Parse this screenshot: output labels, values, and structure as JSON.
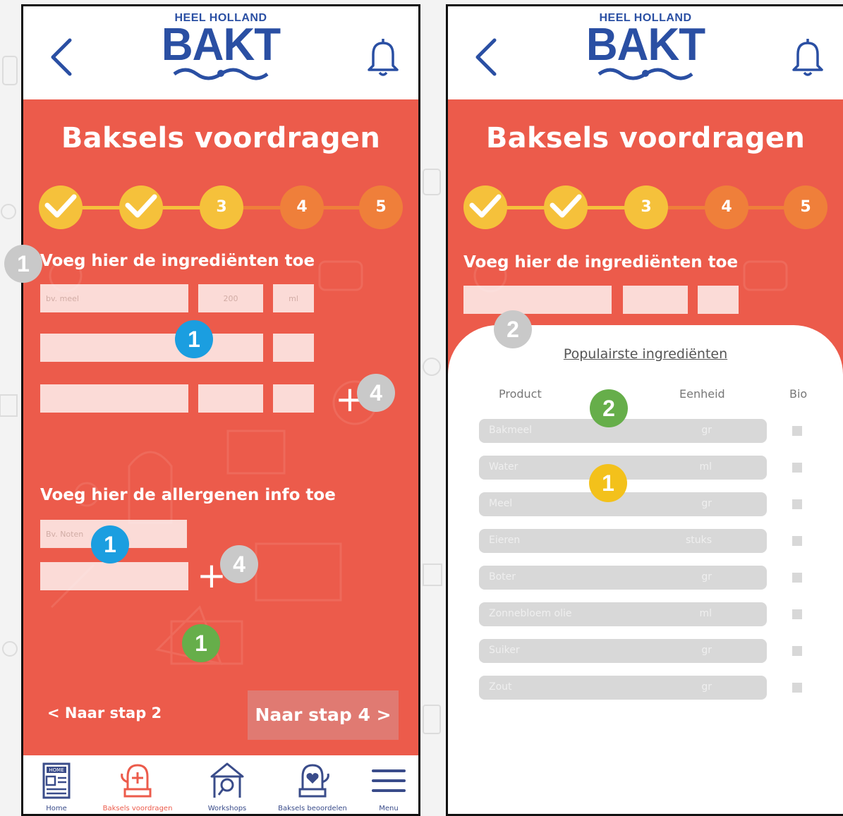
{
  "app": {
    "logo_top": "HEEL HOLLAND",
    "logo_main": "BAKT"
  },
  "left_screen": {
    "title": "Baksels voordragen",
    "steps": [
      "3",
      "4",
      "5"
    ],
    "ingredients_label": "Voeg hier de ingrediënten toe",
    "ingredient_placeholders": [
      "bv. meel",
      "200",
      "ml"
    ],
    "allergens_label": "Voeg hier de allergenen info toe",
    "allergen_placeholder": "Bv. Noten",
    "plus_symbol": "+",
    "prev_button": "< Naar stap 2",
    "next_button": "Naar stap 4 >",
    "badges": {
      "gray_1": "1",
      "blue_1": "1",
      "blue_2": "1",
      "green_1": "1",
      "gray_4a": "4",
      "gray_4b": "4"
    }
  },
  "right_screen": {
    "title": "Baksels voordragen",
    "steps": [
      "3",
      "4",
      "5"
    ],
    "ingredients_label": "Voeg hier de ingrediënten toe",
    "popular_title": "Populairste ingrediënten",
    "columns": {
      "product": "Product",
      "unit": "Eenheid",
      "bio": "Bio"
    },
    "popular_ingredients": [
      {
        "name": "Bakmeel",
        "unit": "gr"
      },
      {
        "name": "Water",
        "unit": "ml"
      },
      {
        "name": "Meel",
        "unit": "gr"
      },
      {
        "name": "Eieren",
        "unit": "stuks"
      },
      {
        "name": "Boter",
        "unit": "gr"
      },
      {
        "name": "Zonnebloem olie",
        "unit": "ml"
      },
      {
        "name": "Suiker",
        "unit": "gr"
      },
      {
        "name": "Zout",
        "unit": "gr"
      }
    ],
    "badges": {
      "gray_2": "2",
      "green_2": "2",
      "yellow_1": "1"
    }
  },
  "tabbar": {
    "items": [
      {
        "label": "Home",
        "icon": "newspaper-icon"
      },
      {
        "label": "Baksels voordragen",
        "icon": "oven-mitt-plus-icon"
      },
      {
        "label": "Workshops",
        "icon": "tent-search-icon"
      },
      {
        "label": "Baksels beoordelen",
        "icon": "oven-mitt-heart-icon"
      },
      {
        "label": "Menu",
        "icon": "hamburger-menu-icon"
      }
    ],
    "home_icon_text": "HOME"
  },
  "colors": {
    "primary_red": "#ec5b4b",
    "brand_blue": "#2a4fa3",
    "step_yellow": "#f5c13b",
    "step_orange": "#ef7f3a"
  }
}
